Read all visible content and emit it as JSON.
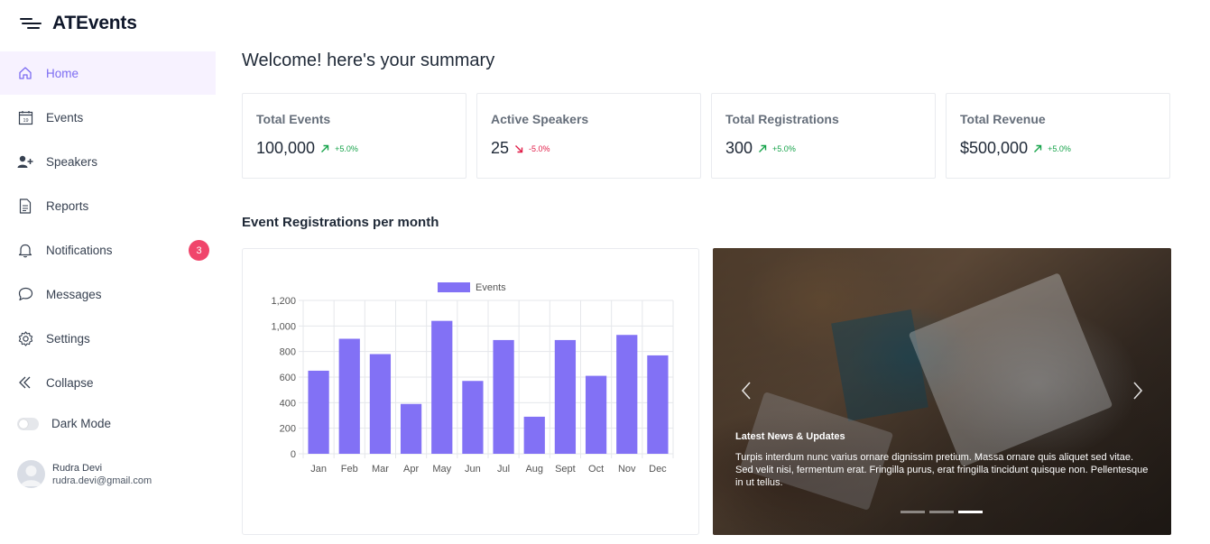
{
  "app": {
    "title": "ATEvents"
  },
  "sidebar": {
    "items": [
      {
        "label": "Home",
        "icon": "home-icon",
        "active": true
      },
      {
        "label": "Events",
        "icon": "calendar-icon",
        "calendar_day": "19"
      },
      {
        "label": "Speakers",
        "icon": "user-plus-icon"
      },
      {
        "label": "Reports",
        "icon": "document-icon"
      },
      {
        "label": "Notifications",
        "icon": "bell-icon",
        "badge": "3"
      },
      {
        "label": "Messages",
        "icon": "chat-bubble-icon"
      },
      {
        "label": "Settings",
        "icon": "gear-icon"
      },
      {
        "label": "Collapse",
        "icon": "double-chevron-left-icon"
      }
    ],
    "dark_mode_label": "Dark Mode",
    "dark_mode_on": false,
    "user": {
      "name": "Rudra Devi",
      "email": "rudra.devi@gmail.com"
    }
  },
  "main": {
    "welcome": "Welcome! here's your summary",
    "cards": [
      {
        "title": "Total Events",
        "value": "100,000",
        "change": "+5.0%",
        "trend": "up"
      },
      {
        "title": "Active Speakers",
        "value": "25",
        "change": "-5.0%",
        "trend": "down"
      },
      {
        "title": "Total Registrations",
        "value": "300",
        "change": "+5.0%",
        "trend": "up"
      },
      {
        "title": "Total Revenue",
        "value": "$500,000",
        "change": "+5.0%",
        "trend": "up"
      }
    ],
    "chart_title": "Event Registrations per month",
    "news": {
      "title": "Latest News & Updates",
      "body": "Turpis interdum nunc varius ornare dignissim pretium. Massa ornare quis aliquet sed vitae. Sed velit nisi, fermentum erat. Fringilla purus, erat fringilla tincidunt quisque non. Pellentesque in ut tellus.",
      "slides": 3,
      "active_slide": 3
    }
  },
  "colors": {
    "accent": "#8271f5",
    "badge": "#f0456b",
    "up": "#16a34a",
    "down": "#e11d48"
  },
  "chart_data": {
    "type": "bar",
    "categories": [
      "Jan",
      "Feb",
      "Mar",
      "Apr",
      "May",
      "Jun",
      "Jul",
      "Aug",
      "Sept",
      "Oct",
      "Nov",
      "Dec"
    ],
    "series": [
      {
        "name": "Events",
        "values": [
          650,
          900,
          780,
          390,
          1040,
          570,
          890,
          290,
          890,
          610,
          930,
          770
        ],
        "color": "#8271f5"
      }
    ],
    "yticks": [
      "0",
      "200",
      "400",
      "600",
      "800",
      "1,000",
      "1,200"
    ],
    "ylim": [
      0,
      1200
    ],
    "grid": true,
    "legend": "top"
  }
}
